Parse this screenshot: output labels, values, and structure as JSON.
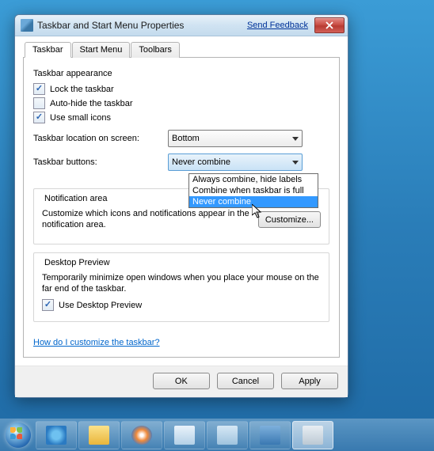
{
  "window": {
    "title": "Taskbar and Start Menu Properties",
    "feedback": "Send Feedback"
  },
  "tabs": [
    {
      "label": "Taskbar",
      "active": true
    },
    {
      "label": "Start Menu",
      "active": false
    },
    {
      "label": "Toolbars",
      "active": false
    }
  ],
  "appearance": {
    "heading": "Taskbar appearance",
    "lock": {
      "label": "Lock the taskbar",
      "checked": true
    },
    "autohide": {
      "label": "Auto-hide the taskbar",
      "checked": false
    },
    "smallicons": {
      "label": "Use small icons",
      "checked": true
    }
  },
  "location": {
    "label": "Taskbar location on screen:",
    "value": "Bottom"
  },
  "buttons": {
    "label": "Taskbar buttons:",
    "value": "Never combine",
    "options": [
      "Always combine, hide labels",
      "Combine when taskbar is full",
      "Never combine"
    ],
    "selected_index": 2
  },
  "notification": {
    "legend": "Notification area",
    "desc": "Customize which icons and notifications appear in the notification area.",
    "button": "Customize..."
  },
  "preview": {
    "legend": "Desktop Preview",
    "desc": "Temporarily minimize open windows when you place your mouse on the far end of the taskbar.",
    "check": {
      "label": "Use Desktop Preview",
      "checked": true
    }
  },
  "help_link": "How do I customize the taskbar?",
  "dialog_buttons": {
    "ok": "OK",
    "cancel": "Cancel",
    "apply": "Apply"
  },
  "taskbar_items": [
    "start",
    "ie",
    "explorer",
    "wmp",
    "app1",
    "app2",
    "app3",
    "app4"
  ],
  "taskbar_active_index": 7
}
